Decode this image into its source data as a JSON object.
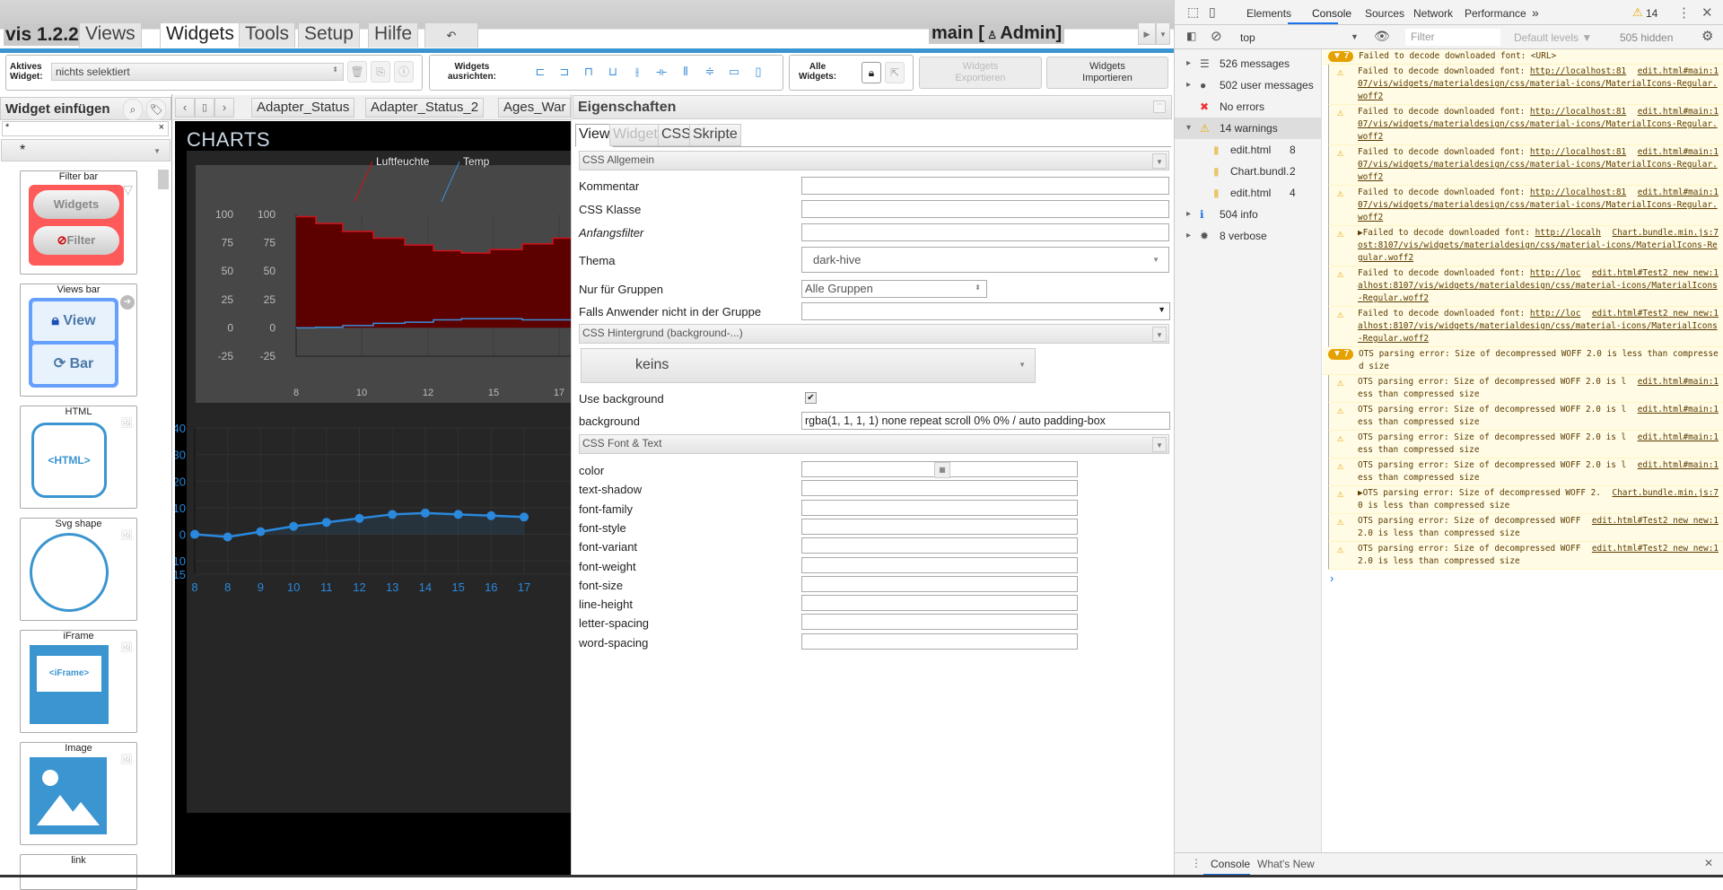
{
  "app": {
    "version_label": "vis 1.2.2",
    "menu_tabs": [
      "Views",
      "Widgets",
      "Tools",
      "Setup",
      "Hilfe"
    ],
    "active_menu_tab": "Widgets",
    "undo_icon": "undo-icon",
    "view_user": "main [",
    "user_name": "Admin]"
  },
  "toolbar": {
    "active_widget_label_1": "Aktives",
    "active_widget_label_2": "Widget:",
    "active_widget_value": "nichts selektiert",
    "align_label_1": "Widgets",
    "align_label_2": "ausrichten:",
    "all_widgets_label_1": "Alle",
    "all_widgets_label_2": "Widgets:",
    "export_label_1": "Widgets",
    "export_label_2": "Exportieren",
    "import_label_1": "Widgets",
    "import_label_2": "Importieren"
  },
  "left_panel": {
    "title": "Widget einfügen",
    "filter_value": "*",
    "clear_icon": "×",
    "set_value": "*",
    "widgets": [
      {
        "name": "Filter bar",
        "btn1": "Widgets",
        "btn2": "Filter"
      },
      {
        "name": "Views bar",
        "btn1": "View",
        "btn2": "Bar"
      },
      {
        "name": "HTML",
        "preview": "<HTML>"
      },
      {
        "name": "Svg shape"
      },
      {
        "name": "iFrame",
        "preview": "<iFrame>"
      },
      {
        "name": "Image"
      },
      {
        "name": "link"
      }
    ]
  },
  "view_tabs": [
    "Adapter_Status",
    "Adapter_Status_2",
    "Ages_War"
  ],
  "canvas": {
    "title": "CHARTS",
    "background": "#000000"
  },
  "chart_data": [
    {
      "type": "area",
      "step": true,
      "x_ticks": [
        "8",
        "10",
        "12",
        "15",
        "17"
      ],
      "y_ticks": [
        100,
        75,
        50,
        25,
        0,
        -25
      ],
      "ylim": [
        -25,
        100
      ],
      "legend": "top-right",
      "series": [
        {
          "name": "Luftfeuchte",
          "color": "#d0121b",
          "fill": "#5c0000",
          "values": [
            98,
            92,
            85,
            79,
            73,
            68,
            66,
            69,
            74,
            79
          ]
        },
        {
          "name": "Temp",
          "color": "#3a8ed8",
          "values": [
            0,
            0.5,
            2,
            4,
            5,
            7,
            8,
            8,
            7,
            7
          ]
        }
      ]
    },
    {
      "type": "line",
      "categories": [
        "8",
        "8",
        "9",
        "10",
        "11",
        "12",
        "13",
        "14",
        "15",
        "16",
        "17"
      ],
      "y_ticks": [
        40,
        30,
        20,
        10,
        0,
        -10,
        -15
      ],
      "ylim": [
        -15,
        40
      ],
      "grid": true,
      "series": [
        {
          "color": "#2a88dd",
          "values": [
            0,
            -1,
            1,
            3,
            4.5,
            6,
            7.5,
            8,
            7.5,
            7,
            6.5
          ]
        }
      ]
    }
  ],
  "properties": {
    "title": "Eigenschaften",
    "tabs": [
      "View",
      "Widget",
      "CSS",
      "Skripte"
    ],
    "section_general": "CSS Allgemein",
    "rows": {
      "kommentar": "Kommentar",
      "css_klasse": "CSS Klasse",
      "anfangsfilter": "Anfangsfilter",
      "thema": "Thema",
      "thema_value": "dark-hive",
      "gruppen": "Nur für Gruppen",
      "gruppen_value": "Alle Gruppen",
      "falls": "Falls Anwender nicht in der Gruppe"
    },
    "section_background": "CSS Hintergrund (background-...)",
    "background_preset": "keins",
    "use_background": "Use background",
    "use_background_checked": true,
    "background_label": "background",
    "background_value": "rgba(1, 1, 1, 1) none repeat scroll 0% 0% / auto padding-box",
    "section_font": "CSS Font & Text",
    "font_rows": [
      "color",
      "text-shadow",
      "font-family",
      "font-style",
      "font-variant",
      "font-weight",
      "font-size",
      "line-height",
      "letter-spacing",
      "word-spacing"
    ]
  },
  "devtools": {
    "tabs": [
      "Elements",
      "Console",
      "Sources",
      "Network",
      "Performance"
    ],
    "active_tab": "Console",
    "warning_count": "14",
    "context": "top",
    "filter_placeholder": "Filter",
    "levels": "Default levels ▼",
    "hidden": "505 hidden",
    "sidebar": [
      {
        "label": "526 messages",
        "icon": "list-icon"
      },
      {
        "label": "502 user messages",
        "icon": "user-icon"
      },
      {
        "label": "No errors",
        "icon": "error-icon"
      },
      {
        "label": "14 warnings",
        "icon": "warning-icon"
      },
      {
        "label": "edit.html",
        "count": "8",
        "icon": "file-icon"
      },
      {
        "label": "Chart.bundl...",
        "count": "2",
        "icon": "file-icon"
      },
      {
        "label": "edit.html",
        "count": "4",
        "icon": "file-icon"
      },
      {
        "label": "504 info",
        "icon": "info-icon"
      },
      {
        "label": "8 verbose",
        "icon": "bug-icon"
      }
    ],
    "messages": [
      {
        "group": true,
        "badge": "7",
        "text": "Failed to decode downloaded font: <URL>"
      },
      {
        "text": "Failed to decode downloaded font: ",
        "url": "http://localhost:8107/vis/widgets/materialdesign/css/material-icons/MaterialIcons-Regular.woff2",
        "source": "edit.html#main:1"
      },
      {
        "text": "Failed to decode downloaded font: ",
        "url": "http://localhost:8107/vis/widgets/materialdesign/css/material-icons/MaterialIcons-Regular.woff2",
        "source": "edit.html#main:1"
      },
      {
        "text": "Failed to decode downloaded font: ",
        "url": "http://localhost:8107/vis/widgets/materialdesign/css/material-icons/MaterialIcons-Regular.woff2",
        "source": "edit.html#main:1"
      },
      {
        "text": "Failed to decode downloaded font: ",
        "url": "http://localhost:8107/vis/widgets/materialdesign/css/material-icons/MaterialIcons-Regular.woff2",
        "source": "edit.html#main:1"
      },
      {
        "text": "▶Failed to decode downloaded font: ",
        "url": "http://localhost:8107/vis/widgets/materialdesign/css/material-icons/MaterialIcons-Regular.woff2",
        "source": "Chart.bundle.min.js:7"
      },
      {
        "text": "Failed to decode downloaded font: ",
        "url": "http://localhost:8107/vis/widgets/materialdesign/css/material-icons/MaterialIcons-Regular.woff2",
        "source": "edit.html#Test2 new new:1"
      },
      {
        "text": "Failed to decode downloaded font: ",
        "url": "http://localhost:8107/vis/widgets/materialdesign/css/material-icons/MaterialIcons-Regular.woff2",
        "source": "edit.html#Test2 new new:1"
      },
      {
        "group": true,
        "badge": "7",
        "text": "OTS parsing error: Size of decompressed WOFF 2.0 is less than compressed size"
      },
      {
        "text": "OTS parsing error: Size of decompressed WOFF 2.0 is less than compressed size",
        "source": "edit.html#main:1"
      },
      {
        "text": "OTS parsing error: Size of decompressed WOFF 2.0 is less than compressed size",
        "source": "edit.html#main:1"
      },
      {
        "text": "OTS parsing error: Size of decompressed WOFF 2.0 is less than compressed size",
        "source": "edit.html#main:1"
      },
      {
        "text": "OTS parsing error: Size of decompressed WOFF 2.0 is less than compressed size",
        "source": "edit.html#main:1"
      },
      {
        "text": "▶OTS parsing error: Size of decompressed WOFF 2.0 is less than compressed size",
        "source": "Chart.bundle.min.js:7"
      },
      {
        "text": "OTS parsing error: Size of decompressed WOFF 2.0 is less than compressed size",
        "source": "edit.html#Test2 new new:1"
      },
      {
        "text": "OTS parsing error: Size of decompressed WOFF 2.0 is less than compressed size",
        "source": "edit.html#Test2 new new:1"
      }
    ],
    "prompt": "›",
    "drawer_tabs": [
      "Console",
      "What's New"
    ]
  }
}
